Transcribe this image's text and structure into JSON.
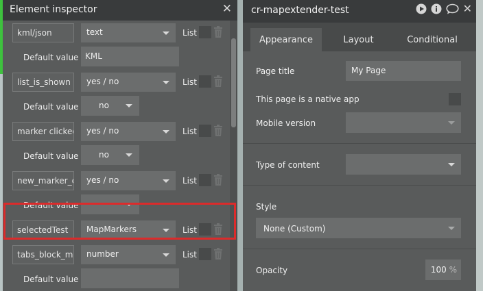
{
  "element_inspector": {
    "title": "Element inspector",
    "close_icon": "close-icon",
    "rows": [
      {
        "kind": "field",
        "name": "kml/json",
        "type": "text",
        "list_label": "List"
      },
      {
        "kind": "default_text",
        "label": "Default value",
        "value": "KML"
      },
      {
        "kind": "field",
        "name": "list_is_shown",
        "type": "yes / no",
        "list_label": "List"
      },
      {
        "kind": "default_select",
        "label": "Default value",
        "value": "no"
      },
      {
        "kind": "field",
        "name": "marker clicked",
        "type": "yes / no",
        "list_label": "List"
      },
      {
        "kind": "default_select",
        "label": "Default value",
        "value": "no"
      },
      {
        "kind": "field",
        "name": "new_marker_cr",
        "type": "yes / no",
        "list_label": "List"
      },
      {
        "kind": "default_select",
        "label": "Default value",
        "value": ""
      },
      {
        "kind": "field",
        "name": "selectedTest",
        "type": "MapMarkers",
        "list_label": "List",
        "highlighted": true
      },
      {
        "kind": "field",
        "name": "tabs_block_map",
        "type": "number",
        "list_label": "List"
      },
      {
        "kind": "default_text",
        "label": "Default value",
        "value": ""
      }
    ]
  },
  "page_panel": {
    "title": "cr-mapextender-test",
    "icons": [
      "play-icon",
      "info-icon",
      "comment-icon",
      "close-icon"
    ],
    "tabs": [
      {
        "label": "Appearance",
        "active": true
      },
      {
        "label": "Layout",
        "active": false
      },
      {
        "label": "Conditional",
        "active": false
      }
    ],
    "page_title_label": "Page title",
    "page_title_value": "My Page",
    "native_app_label": "This page is a native app",
    "mobile_version_label": "Mobile version",
    "mobile_version_value": "",
    "type_of_content_label": "Type of content",
    "type_of_content_value": "",
    "style_label": "Style",
    "style_value": "None (Custom)",
    "opacity_label": "Opacity",
    "opacity_value": "100",
    "opacity_unit": "%"
  },
  "colors": {
    "highlight": "#dc2b2b",
    "panel_bg": "#595b5b",
    "titlebar_bg": "#393b3c"
  }
}
